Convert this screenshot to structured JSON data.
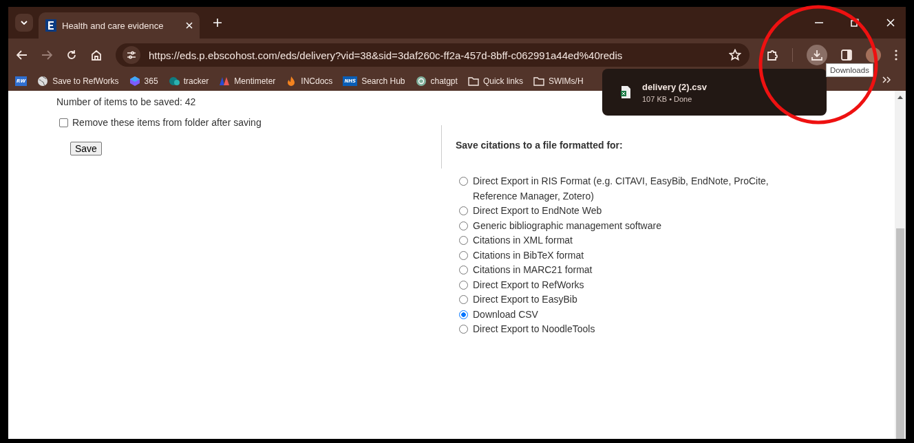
{
  "tab_strip": {
    "tab_title": "Health and care evidence"
  },
  "address_bar": {
    "url": "https://eds.p.ebscohost.com/eds/delivery?vid=38&sid=3daf260c-ff2a-457d-8bff-c062991a44ed%40redis"
  },
  "bookmarks": [
    {
      "kind": "rw",
      "badge": "RW"
    },
    {
      "kind": "globe",
      "label": "Save to RefWorks"
    },
    {
      "kind": "cube",
      "label": "365"
    },
    {
      "kind": "sp",
      "label": "tracker"
    },
    {
      "kind": "m",
      "label": "Mentimeter"
    },
    {
      "kind": "flame",
      "label": "INCdocs"
    },
    {
      "kind": "nhs",
      "badge": "NHS",
      "label": "Search Hub"
    },
    {
      "kind": "chat",
      "label": "chatgpt"
    },
    {
      "kind": "folder",
      "label": "Quick links"
    },
    {
      "kind": "folder",
      "label": "SWIMs/H"
    }
  ],
  "downloads_popup": {
    "file_name": "delivery (2).csv",
    "details": "107 KB • Done"
  },
  "tooltip": "Downloads",
  "page": {
    "item_count": "Number of items to be saved: 42",
    "remove_option": {
      "label": "Remove these items from folder after saving",
      "checked": false
    },
    "save_button": "Save",
    "format_heading": "Save citations to a file formatted for:",
    "formats": [
      {
        "label": "Direct Export in RIS Format (e.g. CITAVI, EasyBib, EndNote, ProCite, Reference Manager, Zotero)",
        "selected": false
      },
      {
        "label": "Direct Export to EndNote Web",
        "selected": false
      },
      {
        "label": "Generic bibliographic management software",
        "selected": false
      },
      {
        "label": "Citations in XML format",
        "selected": false
      },
      {
        "label": "Citations in BibTeX format",
        "selected": false
      },
      {
        "label": "Citations in MARC21 format",
        "selected": false
      },
      {
        "label": "Direct Export to RefWorks",
        "selected": false
      },
      {
        "label": "Direct Export to EasyBib",
        "selected": false
      },
      {
        "label": "Download CSV",
        "selected": true
      },
      {
        "label": "Direct Export to NoodleTools",
        "selected": false
      }
    ]
  }
}
